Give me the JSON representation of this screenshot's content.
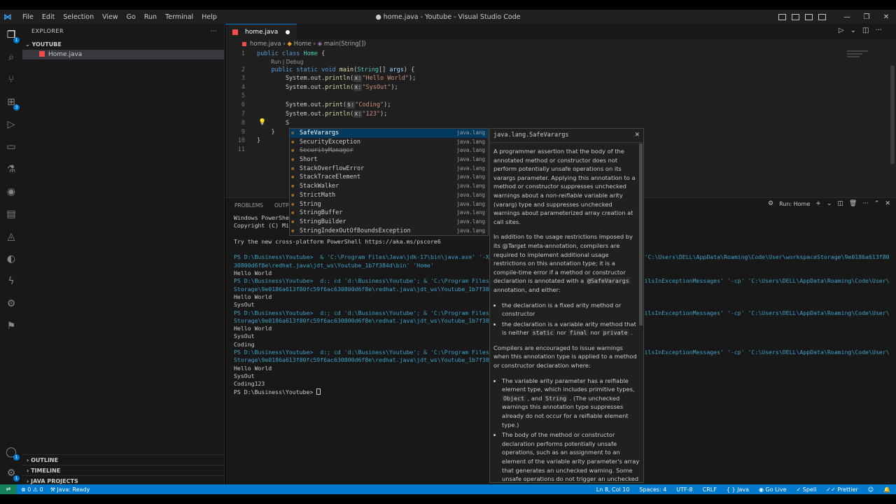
{
  "window": {
    "title": "● home.java - Youtube - Visual Studio Code"
  },
  "menu": [
    "File",
    "Edit",
    "Selection",
    "View",
    "Go",
    "Run",
    "Terminal",
    "Help"
  ],
  "activity_badges": {
    "explorer": "1",
    "extensions": "3",
    "accounts": "1",
    "settings": "1"
  },
  "sidebar": {
    "title": "EXPLORER",
    "folder": "YOUTUBE",
    "file": "Home.java",
    "sections": [
      "OUTLINE",
      "TIMELINE",
      "JAVA PROJECTS"
    ]
  },
  "editor": {
    "tab_label": "home.java",
    "breadcrumb": {
      "file": "home.java",
      "cls": "Home",
      "method": "main(String[])"
    },
    "codelens": "Run | Debug",
    "line_numbers": [
      "1",
      "2",
      "3",
      "4",
      "5",
      "6",
      "7",
      "8",
      "9",
      "10",
      "11"
    ],
    "code": {
      "l1_kw": "public class ",
      "l1_ty": "Home",
      "l1_rest": " {",
      "l2_kw": "    public static void ",
      "l2_fn": "main",
      "l2_rest1": "(",
      "l2_ty": "String",
      "l2_rest2": "[] ",
      "l2_va": "args",
      "l2_rest3": ") {",
      "l3_pre": "        System.out.",
      "l3_fn": "println",
      "l3_hint": "x:",
      "l3_str": "\"Hello World\"",
      "l3_end": ");",
      "l4_pre": "        System.out.",
      "l4_fn": "println",
      "l4_hint": "x:",
      "l4_str": "\"SysOut\"",
      "l4_end": ");",
      "l6_pre": "        System.out.",
      "l6_fn": "print",
      "l6_hint": "s:",
      "l6_str": "\"Coding\"",
      "l6_end": ");",
      "l7_pre": "        System.out.",
      "l7_fn": "println",
      "l7_hint": "x:",
      "l7_str": "\"123\"",
      "l7_end": ");",
      "l8": "        S",
      "l9": "    }",
      "l10": "}"
    }
  },
  "suggest": [
    {
      "name": "SafeVarargs",
      "source": "java.lang",
      "selected": true,
      "strike": false
    },
    {
      "name": "SecurityException",
      "source": "java.lang",
      "selected": false,
      "strike": false
    },
    {
      "name": "SecurityManager",
      "source": "java.lang",
      "selected": false,
      "strike": true
    },
    {
      "name": "Short",
      "source": "java.lang",
      "selected": false,
      "strike": false
    },
    {
      "name": "StackOverflowError",
      "source": "java.lang",
      "selected": false,
      "strike": false
    },
    {
      "name": "StackTraceElement",
      "source": "java.lang",
      "selected": false,
      "strike": false
    },
    {
      "name": "StackWalker",
      "source": "java.lang",
      "selected": false,
      "strike": false
    },
    {
      "name": "StrictMath",
      "source": "java.lang",
      "selected": false,
      "strike": false
    },
    {
      "name": "String",
      "source": "java.lang",
      "selected": false,
      "strike": false
    },
    {
      "name": "StringBuffer",
      "source": "java.lang",
      "selected": false,
      "strike": false
    },
    {
      "name": "StringBuilder",
      "source": "java.lang",
      "selected": false,
      "strike": false
    },
    {
      "name": "StringIndexOutOfBoundsException",
      "source": "java.lang",
      "selected": false,
      "strike": false
    }
  ],
  "docs": {
    "title": "java.lang.SafeVarargs",
    "p1_a": "A programmer assertion that the body of the annotated method or constructor does not perform potentially unsafe operations on its varargs parameter. Applying this annotation to a method or constructor suppresses unchecked warnings about a ",
    "p1_em": "non-reifiable",
    "p1_b": " variable arity (vararg) type and suppresses unchecked warnings about parameterized array creation at call sites.",
    "p2_a": "In addition to the usage restrictions imposed by its @Target meta-annotation, compilers are required to implement additional usage restrictions on this annotation type; it is a compile-time error if a method or constructor declaration is annotated with a ",
    "p2_code": "@SafeVarargs",
    "p2_b": " annotation, and either:",
    "li1": "the declaration is a fixed arity method or constructor",
    "li2_a": "the declaration is a variable arity method that is neither ",
    "li2_c1": "static",
    "li2_mid": " nor ",
    "li2_c2": "final",
    "li2_mid2": " nor ",
    "li2_c3": "private",
    "li2_end": " .",
    "p3": "Compilers are encouraged to issue warnings when this annotation type is applied to a method or constructor declaration where:",
    "li3_a": "The variable arity parameter has a reifiable element type, which includes primitive types, ",
    "li3_c1": "Object",
    "li3_mid": " , and ",
    "li3_c2": "String",
    "li3_b": " . (The unchecked warnings this annotation type suppresses already do not occur for a reifiable element type.)",
    "li4": "The body of the method or constructor declaration performs potentially unsafe operations, such as an assignment to an element of the variable arity parameter's array that generates an unchecked warning. Some unsafe operations do not trigger an unchecked warning. For example, the aliasing in"
  },
  "panel": {
    "tabs": [
      "PROBLEMS",
      "OUTPUT"
    ],
    "run_label": "Run: Home",
    "terminal": [
      "Windows PowerShell",
      "Copyright (C) Microsoft Corporation. All rights reserved.",
      "",
      "Try the new cross-platform PowerShell https://aka.ms/pscore6",
      "",
      "PS D:\\Business\\Youtube>  & 'C:\\Program Files\\Java\\jdk-17\\bin\\java.exe' '-XX:+ShowCodeDetailsInExceptionMessages' '-cp' 'C:\\Users\\DELL\\AppData\\Roaming\\Code\\User\\workspaceStorage\\9e0186a613f80fc59f6ac6",
      "30800d6f8e\\redhat.java\\jdt_ws\\Youtube_1b7f384d\\bin' 'Home'",
      "Hello World",
      "PS D:\\Business\\Youtube>  d:; cd 'd:\\Business\\Youtube'; & 'C:\\Program Files\\Java\\jdk-17\\bin\\java.exe' '-XX:+ShowCodeDetailsInExceptionMessages' '-cp' 'C:\\Users\\DELL\\AppData\\Roaming\\Code\\User\\workspace",
      "Storage\\9e0186a613f80fc59f6ac630800d6f8e\\redhat.java\\jdt_ws\\Youtube_1b7f384d\\bin' 'Home'",
      "Hello World",
      "SysOut",
      "PS D:\\Business\\Youtube>  d:; cd 'd:\\Business\\Youtube'; & 'C:\\Program Files\\Java\\jdk-17\\bin\\java.exe' '-XX:+ShowCodeDetailsInExceptionMessages' '-cp' 'C:\\Users\\DELL\\AppData\\Roaming\\Code\\User\\workspace",
      "Storage\\9e0186a613f80fc59f6ac630800d6f8e\\redhat.java\\jdt_ws\\Youtube_1b7f384d\\bin' 'Home'",
      "Hello World",
      "SysOut",
      "Coding",
      "PS D:\\Business\\Youtube>  d:; cd 'd:\\Business\\Youtube'; & 'C:\\Program Files\\Java\\jdk-17\\bin\\java.exe' '-XX:+ShowCodeDetailsInExceptionMessages' '-cp' 'C:\\Users\\DELL\\AppData\\Roaming\\Code\\User\\workspace",
      "Storage\\9e0186a613f80fc59f6ac630800d6f8e\\redhat.java\\jdt_ws\\Youtube_1b7f384d\\bin' 'Home'",
      "Hello World",
      "SysOut",
      "Coding123",
      "PS D:\\Business\\Youtube> "
    ]
  },
  "status": {
    "errors": "⊗ 0 ⚠ 0",
    "java": "Java: Ready",
    "position": "Ln 8, Col 10",
    "spaces": "Spaces: 4",
    "encoding": "UTF-8",
    "eol": "CRLF",
    "language": "{ } Java",
    "golive": "Go Live",
    "spell": "Spell",
    "prettier": "Prettier"
  }
}
